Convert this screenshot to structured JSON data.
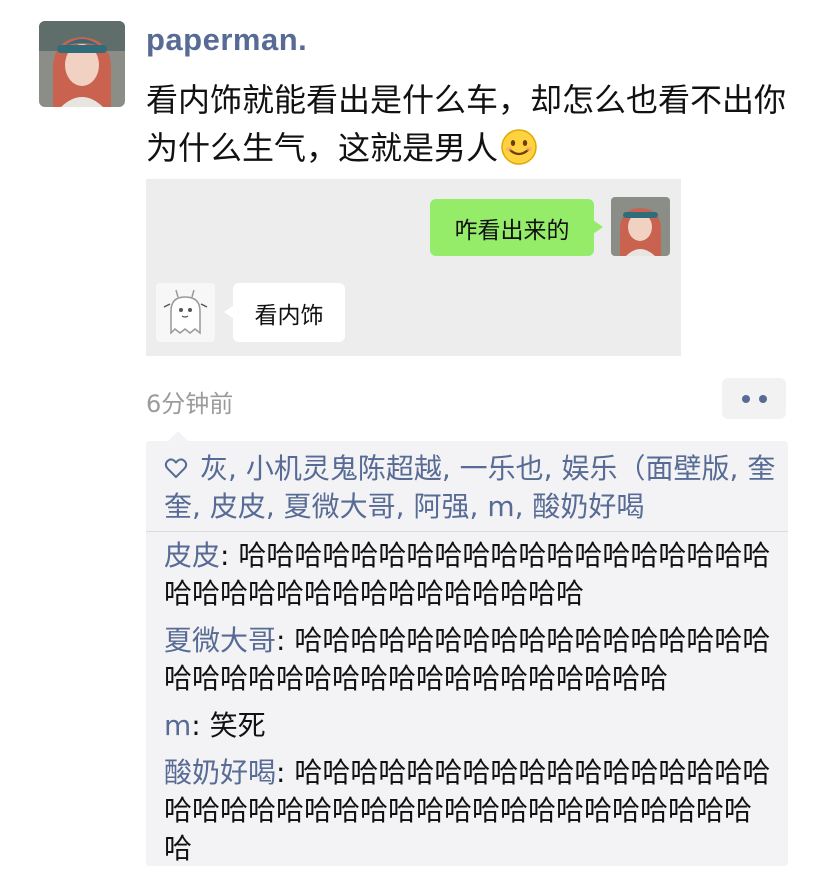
{
  "post": {
    "username": "paperman.",
    "text": "看内饰就能看出是什么车，却怎么也看不出你为什么生气，这就是男人",
    "emoji": "smile-emoji",
    "timestamp": "6分钟前"
  },
  "chat_screenshot": {
    "outgoing_message": "咋看出来的",
    "incoming_message": "看内饰"
  },
  "likes": {
    "icon": "heart-icon",
    "names": [
      "灰",
      "小机灵鬼陈超越",
      "一乐也",
      "娱乐（面壁版",
      "奎奎",
      "皮皮",
      "夏微大哥",
      "阿强",
      "m",
      "酸奶好喝"
    ]
  },
  "comments": [
    {
      "author": "皮皮",
      "text": "哈哈哈哈哈哈哈哈哈哈哈哈哈哈哈哈哈哈哈哈哈哈哈哈哈哈哈哈哈哈哈哈哈哈"
    },
    {
      "author": "夏微大哥",
      "text": "哈哈哈哈哈哈哈哈哈哈哈哈哈哈哈哈哈哈哈哈哈哈哈哈哈哈哈哈哈哈哈哈哈哈哈"
    },
    {
      "author": "m",
      "text": "笑死"
    },
    {
      "author": "酸奶好喝",
      "text": "哈哈哈哈哈哈哈哈哈哈哈哈哈哈哈哈哈哈哈哈哈哈哈哈哈哈哈哈哈哈哈哈哈哈哈哈哈哈哈"
    }
  ],
  "colors": {
    "link": "#576b95",
    "bubble_green": "#95ec69",
    "panel_bg": "#f3f3f5"
  }
}
